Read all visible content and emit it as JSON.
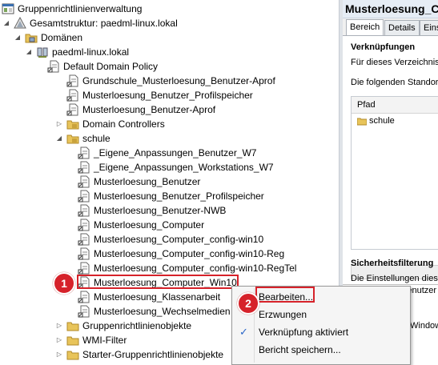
{
  "tree": {
    "root": "Gruppenrichtlinienverwaltung",
    "forest": "Gesamtstruktur: paedml-linux.lokal",
    "domains": "Domänen",
    "domain": "paedml-linux.lokal",
    "domain_items": [
      "Default Domain Policy",
      "Grundschule_Musterloesung_Benutzer-Aprof",
      "Musterloesung_Benutzer_Profilspeicher",
      "Musterloesung_Benutzer-Aprof"
    ],
    "domain_controllers": "Domain Controllers",
    "schule": "schule",
    "schule_items": [
      "_Eigene_Anpassungen_Benutzer_W7",
      "_Eigene_Anpassungen_Workstations_W7",
      "Musterloesung_Benutzer",
      "Musterloesung_Benutzer_Profilspeicher",
      "Musterloesung_Benutzer-NWB",
      "Musterloesung_Computer",
      "Musterloesung_Computer_config-win10",
      "Musterloesung_Computer_config-win10-Reg",
      "Musterloesung_Computer_config-win10-RegTel",
      "Musterloesung_Computer_Win10",
      "Musterloesung_Klassenarbeit",
      "Musterloesung_Wechselmedien"
    ],
    "gpo": "Gruppenrichtlinienobjekte",
    "wmi": "WMI-Filter",
    "starter": "Starter-Gruppenrichtlinienobjekte"
  },
  "right": {
    "title": "Musterloesung_C",
    "tabs": [
      "Bereich",
      "Details",
      "Eins"
    ],
    "links_heading": "Verknüpfungen",
    "links_desc": "Für dieses Verzeichnis",
    "locations_desc": "Die folgenden Standort",
    "col_path": "Pfad",
    "path_row": "schule",
    "security_heading": "Sicherheitsfilterung",
    "security_desc1": "Die Einstellungen diese",
    "security_desc2": "Benutzer und",
    "wmi_fragment": "Windows"
  },
  "context_menu": {
    "items": [
      "Bearbeiten...",
      "Erzwungen",
      "Verknüpfung aktiviert",
      "Bericht speichern..."
    ],
    "checked": "Verknüpfung aktiviert"
  },
  "badges": [
    "1",
    "2"
  ],
  "colors": {
    "highlight": "#d6222a",
    "folder": "#e8c45a",
    "check": "#2a66c8"
  }
}
